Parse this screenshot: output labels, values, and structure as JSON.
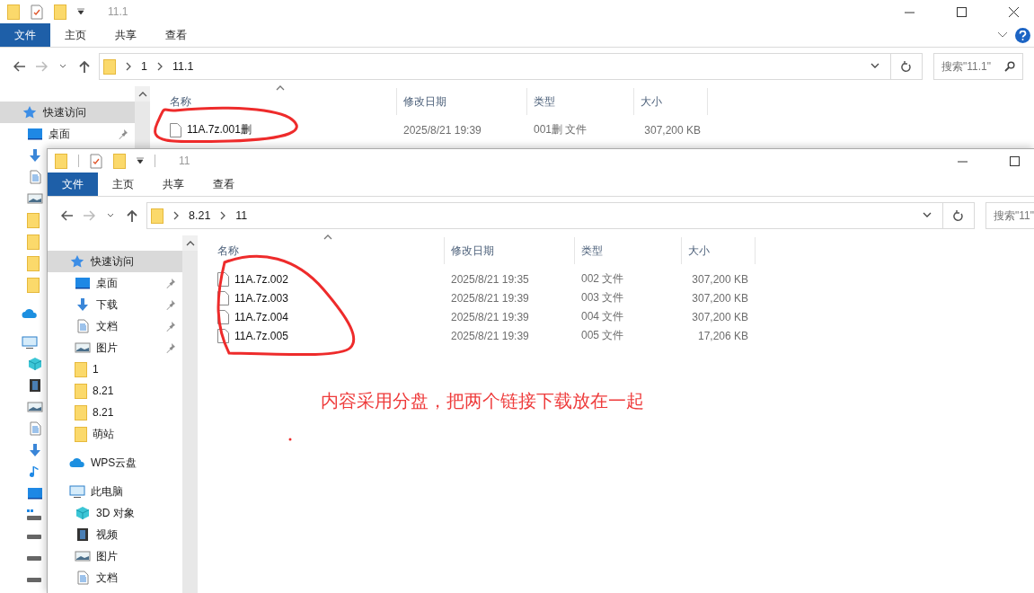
{
  "windows": [
    {
      "title": "11.1",
      "help_button": true,
      "caption_buttons": [
        {
          "kind": "minimize"
        },
        {
          "kind": "maximize"
        },
        {
          "kind": "close"
        }
      ],
      "ribbon_tabs": [
        {
          "label": "文件",
          "selected": true
        },
        {
          "label": "主页",
          "selected": false
        },
        {
          "label": "共享",
          "selected": false
        },
        {
          "label": "查看",
          "selected": false
        }
      ],
      "path": [
        "1",
        "11.1"
      ],
      "search": {
        "placeholder": "搜索\"11.1\""
      },
      "sidebar": [
        {
          "kind": "star",
          "label": "快速访问",
          "selected": true,
          "pinned": false,
          "children": [
            {
              "kind": "desktop",
              "label": "桌面",
              "selected": false,
              "pinned": true
            },
            {
              "kind": "download",
              "selected": false,
              "pinned": false
            },
            {
              "kind": "document",
              "selected": false,
              "pinned": false
            },
            {
              "kind": "pictures",
              "selected": false,
              "pinned": false
            },
            {
              "kind": "folder",
              "selected": false,
              "pinned": false
            },
            {
              "kind": "folder",
              "selected": false,
              "pinned": false
            },
            {
              "kind": "folder",
              "selected": false,
              "pinned": false
            },
            {
              "kind": "folder",
              "selected": false,
              "pinned": false
            }
          ]
        },
        {
          "kind": "cloud",
          "selected": false,
          "pinned": false
        },
        {
          "kind": "computer",
          "selected": false,
          "pinned": false,
          "children": [
            {
              "kind": "cube",
              "selected": false,
              "pinned": false
            },
            {
              "kind": "film",
              "selected": false,
              "pinned": false
            },
            {
              "kind": "pictures",
              "selected": false,
              "pinned": false
            },
            {
              "kind": "document",
              "selected": false,
              "pinned": false
            },
            {
              "kind": "download",
              "selected": false,
              "pinned": false
            },
            {
              "kind": "music",
              "selected": false,
              "pinned": false
            },
            {
              "kind": "desktop",
              "selected": false,
              "pinned": false
            },
            {
              "kind": "netdrive",
              "selected": false,
              "pinned": false
            },
            {
              "kind": "drive",
              "selected": false,
              "pinned": false
            },
            {
              "kind": "drive",
              "selected": false,
              "pinned": false
            },
            {
              "kind": "drive",
              "selected": false,
              "pinned": false
            }
          ]
        }
      ],
      "columns": [
        "名称",
        "修改日期",
        "类型",
        "大小"
      ],
      "files": [
        {
          "name": "11A.7z.001删",
          "modified": "2025/8/21 19:39",
          "type": "001删 文件",
          "size": "307,200 KB"
        }
      ]
    },
    {
      "title": "11",
      "help_button": false,
      "caption_buttons": [
        {
          "kind": "minimize"
        },
        {
          "kind": "maximize"
        }
      ],
      "ribbon_tabs": [
        {
          "label": "文件",
          "selected": true
        },
        {
          "label": "主页",
          "selected": false
        },
        {
          "label": "共享",
          "selected": false
        },
        {
          "label": "查看",
          "selected": false
        }
      ],
      "path": [
        "8.21",
        "11"
      ],
      "search": {
        "placeholder": "搜索\"11\""
      },
      "sidebar": [
        {
          "kind": "star",
          "label": "快速访问",
          "selected": true,
          "pinned": false,
          "children": [
            {
              "kind": "desktop",
              "label": "桌面",
              "selected": false,
              "pinned": true
            },
            {
              "kind": "download",
              "label": "下载",
              "selected": false,
              "pinned": true
            },
            {
              "kind": "document",
              "label": "文档",
              "selected": false,
              "pinned": true
            },
            {
              "kind": "pictures",
              "label": "图片",
              "selected": false,
              "pinned": true
            },
            {
              "kind": "folder",
              "label": "1",
              "selected": false,
              "pinned": false
            },
            {
              "kind": "folder",
              "label": "8.21",
              "selected": false,
              "pinned": false
            },
            {
              "kind": "folder",
              "label": "8.21",
              "selected": false,
              "pinned": false
            },
            {
              "kind": "folder",
              "label": "萌站",
              "selected": false,
              "pinned": false
            }
          ]
        },
        {
          "kind": "cloud",
          "label": "WPS云盘",
          "selected": false,
          "pinned": false
        },
        {
          "kind": "computer",
          "label": "此电脑",
          "selected": false,
          "pinned": false,
          "children": [
            {
              "kind": "cube",
              "label": "3D 对象",
              "selected": false,
              "pinned": false
            },
            {
              "kind": "film",
              "label": "视频",
              "selected": false,
              "pinned": false
            },
            {
              "kind": "pictures",
              "label": "图片",
              "selected": false,
              "pinned": false
            },
            {
              "kind": "document",
              "label": "文档",
              "selected": false,
              "pinned": false
            }
          ]
        }
      ],
      "columns": [
        "名称",
        "修改日期",
        "类型",
        "大小"
      ],
      "files": [
        {
          "name": "11A.7z.002",
          "modified": "2025/8/21 19:35",
          "type": "002 文件",
          "size": "307,200 KB"
        },
        {
          "name": "11A.7z.003",
          "modified": "2025/8/21 19:39",
          "type": "003 文件",
          "size": "307,200 KB"
        },
        {
          "name": "11A.7z.004",
          "modified": "2025/8/21 19:39",
          "type": "004 文件",
          "size": "307,200 KB"
        },
        {
          "name": "11A.7z.005",
          "modified": "2025/8/21 19:39",
          "type": "005 文件",
          "size": "17,206 KB"
        }
      ]
    }
  ],
  "annotation": {
    "note": "内容采用分盘，把两个链接下载放在一起"
  }
}
